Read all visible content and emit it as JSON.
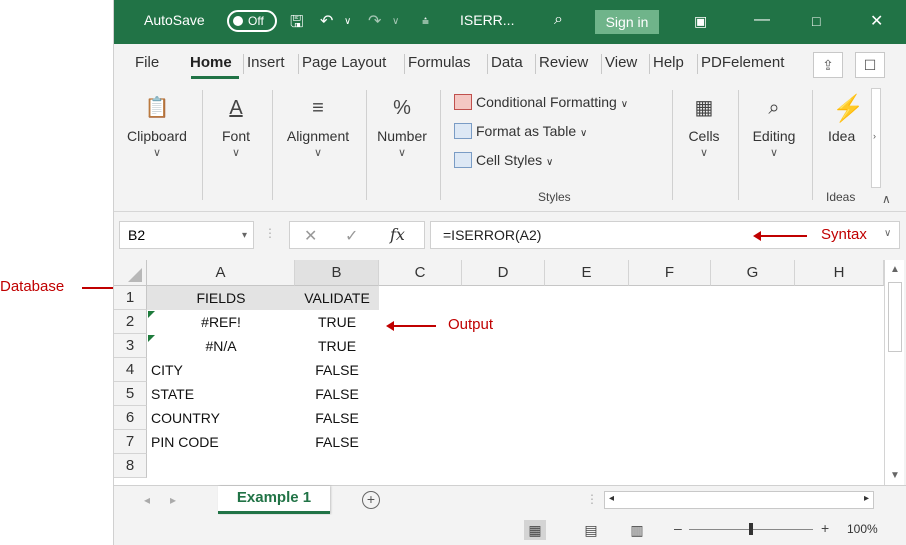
{
  "titlebar": {
    "autosave_label": "AutoSave",
    "toggle_label": "Off",
    "doc_title": "ISERR...",
    "signin_label": "Sign in"
  },
  "menu": {
    "items": [
      "File",
      "Home",
      "Insert",
      "Page Layout",
      "Formulas",
      "Data",
      "Review",
      "View",
      "Help",
      "PDFelement"
    ]
  },
  "ribbon": {
    "clipboard": "Clipboard",
    "font": "Font",
    "alignment": "Alignment",
    "number": "Number",
    "conditional_formatting": "Conditional Formatting",
    "format_as_table": "Format as Table",
    "cell_styles": "Cell Styles",
    "styles_group": "Styles",
    "cells": "Cells",
    "editing": "Editing",
    "ideas": "Idea",
    "ideas_group": "Ideas"
  },
  "formula_bar": {
    "name_box": "B2",
    "fx_label": "fx",
    "formula": "=ISERROR(A2)"
  },
  "grid": {
    "columns": [
      "A",
      "B",
      "C",
      "D",
      "E",
      "F",
      "G",
      "H"
    ],
    "rows": [
      "1",
      "2",
      "3",
      "4",
      "5",
      "6",
      "7",
      "8"
    ],
    "header": {
      "a": "FIELDS",
      "b": "VALIDATE"
    },
    "data": [
      {
        "a": "#REF!",
        "b": "TRUE"
      },
      {
        "a": "#N/A",
        "b": "TRUE"
      },
      {
        "a": "CITY",
        "b": "FALSE"
      },
      {
        "a": "STATE",
        "b": "FALSE"
      },
      {
        "a": "COUNTRY",
        "b": "FALSE"
      },
      {
        "a": "PIN CODE",
        "b": "FALSE"
      }
    ]
  },
  "sheet_tab": "Example 1",
  "status": {
    "zoom": "100%"
  },
  "annotations": {
    "database": "Database",
    "output": "Output",
    "syntax": "Syntax"
  },
  "colors": {
    "excel_green": "#217346",
    "annotation_red": "#c00000"
  }
}
